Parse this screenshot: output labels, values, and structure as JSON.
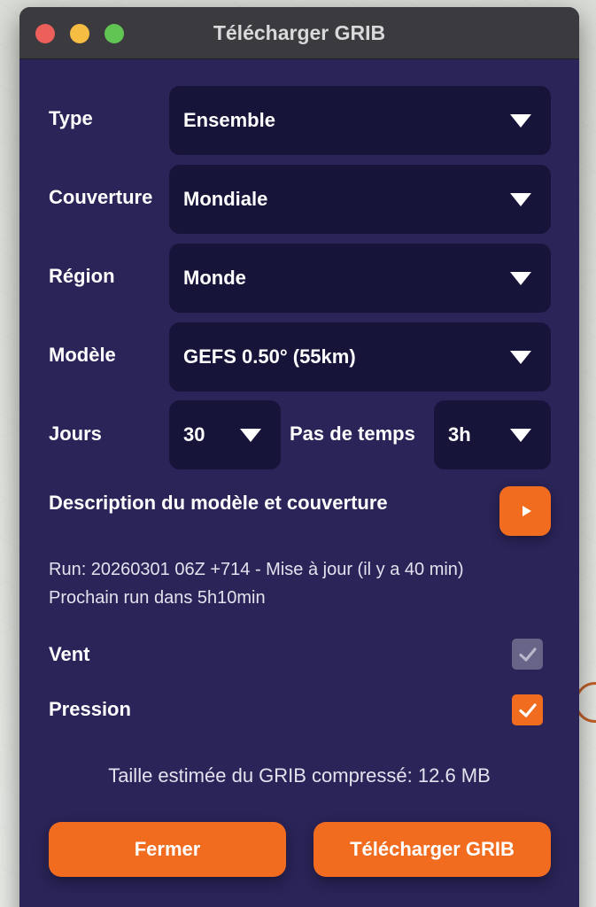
{
  "window": {
    "title": "Télécharger GRIB"
  },
  "form": {
    "type": {
      "label": "Type",
      "value": "Ensemble"
    },
    "coverage": {
      "label": "Couverture",
      "value": "Mondiale"
    },
    "region": {
      "label": "Région",
      "value": "Monde"
    },
    "model": {
      "label": "Modèle",
      "value": "GEFS 0.50° (55km)"
    },
    "days": {
      "label": "Jours",
      "value": "30"
    },
    "timestep": {
      "label": "Pas de temps",
      "value": "3h"
    }
  },
  "description": {
    "label": "Description du modèle et couverture"
  },
  "run_info": {
    "line1": "Run: 20260301 06Z +714 - Mise à jour (il y a 40 min)",
    "line2": "Prochain run dans 5h10min"
  },
  "options": {
    "wind": {
      "label": "Vent",
      "checked": true,
      "enabled": false
    },
    "pressure": {
      "label": "Pression",
      "checked": true,
      "enabled": true
    }
  },
  "estimate": "Taille estimée du GRIB compressé: 12.6 MB",
  "buttons": {
    "close": "Fermer",
    "download": "Télécharger GRIB"
  },
  "colors": {
    "accent": "#f26c1f",
    "panel": "#2a2458",
    "field": "#17143a"
  },
  "icons": {
    "caret": "chevron-down-icon",
    "play": "play-icon",
    "check": "check-icon"
  }
}
